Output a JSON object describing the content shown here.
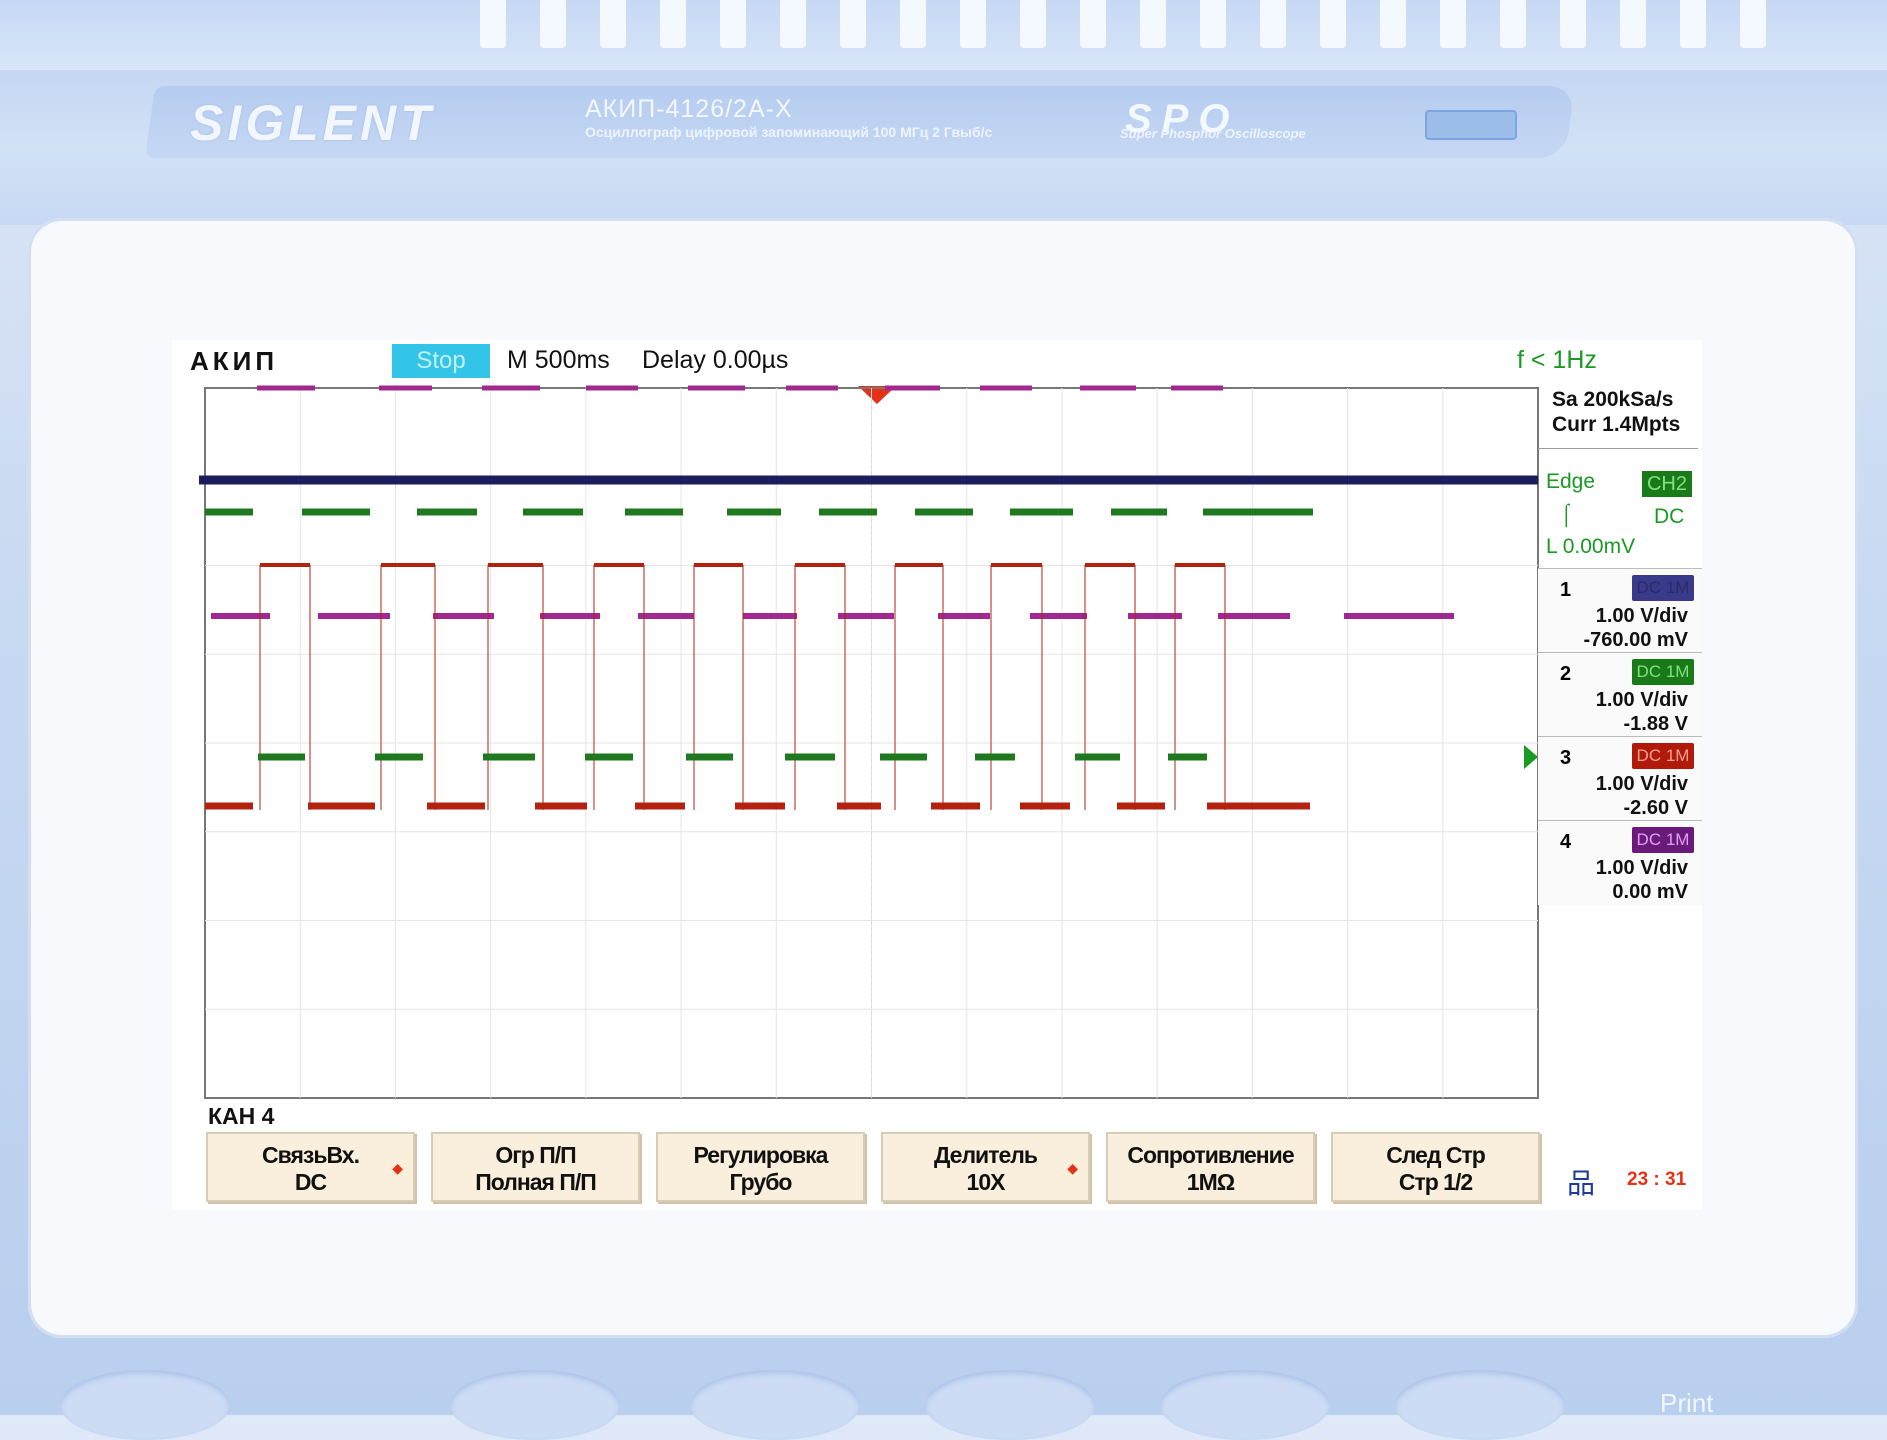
{
  "device": {
    "brand": "SIGLENT",
    "model": "АКИП-4126/2А-Х",
    "description": "Осциллограф цифровой запоминающий  100 МГц  2 Гвыб/с",
    "series_logo": "SPO",
    "series_text": "Super Phosphor Oscilloscope",
    "print_label": "Print"
  },
  "status": {
    "brand_label": "АКИП",
    "run_state": "Stop",
    "timebase": "M 500ms",
    "delay": "Delay 0.00µs",
    "frequency": "f < 1Hz"
  },
  "acquisition": {
    "sample_rate": "Sa 200kSa/s",
    "memory": "Curr 1.4Mpts"
  },
  "trigger": {
    "type": "Edge",
    "source": "CH2",
    "slope_icon": "rising-edge-icon",
    "coupling": "DC",
    "level": "L  0.00mV"
  },
  "channels": [
    {
      "num": "1",
      "coupling": "DC 1M",
      "vdiv": "1.00 V/div",
      "offset": "-760.00 mV",
      "color": "#1a1a6e"
    },
    {
      "num": "2",
      "coupling": "DC 1M",
      "vdiv": "1.00 V/div",
      "offset": "-1.88 V",
      "color": "#1a7a1a"
    },
    {
      "num": "3",
      "coupling": "DC 1M",
      "vdiv": "1.00 V/div",
      "offset": "-2.60 V",
      "color": "#b01a0a"
    },
    {
      "num": "4",
      "coupling": "DC 1M",
      "vdiv": "1.00 V/div",
      "offset": "0.00 mV",
      "color": "#7a1a8a"
    }
  ],
  "menu": {
    "title": "КАН 4",
    "buttons": [
      {
        "line1": "СвязьВх.",
        "line2": "DC",
        "arrow": true
      },
      {
        "line1": "Огр  П/П",
        "line2": "Полная П/П",
        "arrow": false
      },
      {
        "line1": "Регулировка",
        "line2": "Грубо",
        "arrow": false
      },
      {
        "line1": "Делитель",
        "line2": "10X",
        "arrow": true
      },
      {
        "line1": "Сопротивление",
        "line2": "1MΩ",
        "arrow": false
      },
      {
        "line1": "След  Стр",
        "line2": "Стр 1/2",
        "arrow": false
      }
    ]
  },
  "clock": "23 : 31",
  "colors": {
    "trace_magenta": "#a0288f",
    "trace_navy": "#1c1d5c",
    "trace_green": "#1f7a1f",
    "trace_red": "#b3220e",
    "glow_green": "#c8f078",
    "stop_bg": "#33c5e8",
    "trigger_green": "#1a9a22",
    "menu_bg": "#f9efdc"
  }
}
